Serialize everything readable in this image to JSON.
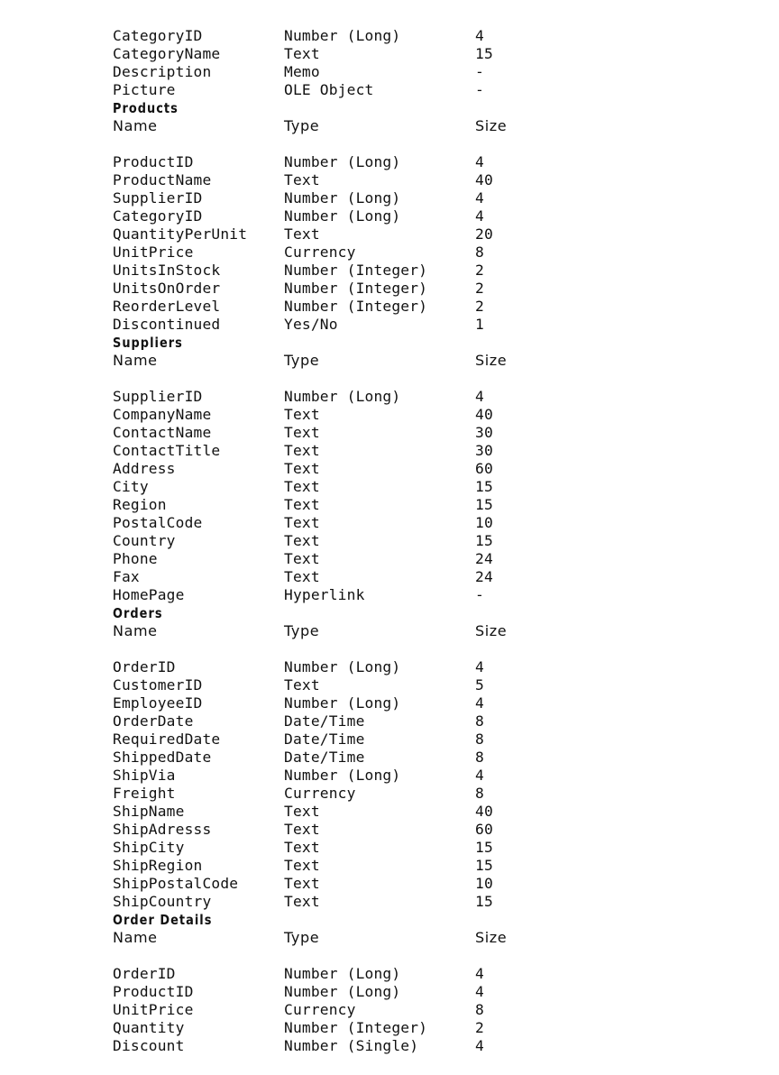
{
  "header_labels": {
    "name": "Name",
    "type": "Type",
    "size": "Size"
  },
  "tables": [
    {
      "title": "",
      "show_header": false,
      "fields": [
        [
          "CategoryID",
          "Number (Long)",
          "4"
        ],
        [
          "CategoryName",
          "Text",
          "15"
        ],
        [
          "Description",
          "Memo",
          "-"
        ],
        [
          "Picture",
          "OLE Object",
          "-"
        ]
      ]
    },
    {
      "title": "Products",
      "show_header": true,
      "fields": [
        [
          "ProductID",
          "Number (Long)",
          "4"
        ],
        [
          "ProductName",
          "Text",
          "40"
        ],
        [
          "SupplierID",
          "Number (Long)",
          "4"
        ],
        [
          "CategoryID",
          "Number (Long)",
          "4"
        ],
        [
          "QuantityPerUnit",
          "Text",
          "20"
        ],
        [
          "UnitPrice",
          "Currency",
          "8"
        ],
        [
          "UnitsInStock",
          "Number (Integer)",
          "2"
        ],
        [
          "UnitsOnOrder",
          "Number (Integer)",
          "2"
        ],
        [
          "ReorderLevel",
          "Number (Integer)",
          "2"
        ],
        [
          "Discontinued",
          "Yes/No",
          "1"
        ]
      ]
    },
    {
      "title": "Suppliers",
      "show_header": true,
      "fields": [
        [
          "SupplierID",
          "Number (Long)",
          "4"
        ],
        [
          "CompanyName",
          "Text",
          "40"
        ],
        [
          "ContactName",
          "Text",
          "30"
        ],
        [
          "ContactTitle",
          "Text",
          "30"
        ],
        [
          "Address",
          "Text",
          "60"
        ],
        [
          "City",
          "Text",
          "15"
        ],
        [
          "Region",
          "Text",
          "15"
        ],
        [
          "PostalCode",
          "Text",
          "10"
        ],
        [
          "Country",
          "Text",
          "15"
        ],
        [
          "Phone",
          "Text",
          "24"
        ],
        [
          "Fax",
          "Text",
          "24"
        ],
        [
          "HomePage",
          "Hyperlink",
          "-"
        ]
      ]
    },
    {
      "title": "Orders",
      "show_header": true,
      "fields": [
        [
          "OrderID",
          "Number (Long)",
          "4"
        ],
        [
          "CustomerID",
          "Text",
          "5"
        ],
        [
          "EmployeeID",
          "Number (Long)",
          "4"
        ],
        [
          "OrderDate",
          "Date/Time",
          "8"
        ],
        [
          "RequiredDate",
          "Date/Time",
          "8"
        ],
        [
          "ShippedDate",
          "Date/Time",
          "8"
        ],
        [
          "ShipVia",
          "Number (Long)",
          "4"
        ],
        [
          "Freight",
          "Currency",
          "8"
        ],
        [
          "ShipName",
          "Text",
          "40"
        ],
        [
          "ShipAdresss",
          "Text",
          "60"
        ],
        [
          "ShipCity",
          "Text",
          "15"
        ],
        [
          "ShipRegion",
          "Text",
          "15"
        ],
        [
          "ShipPostalCode",
          "Text",
          "10"
        ],
        [
          "ShipCountry",
          "Text",
          "15"
        ]
      ]
    },
    {
      "title": "Order Details",
      "show_header": true,
      "fields": [
        [
          "OrderID",
          "Number (Long)",
          "4"
        ],
        [
          "ProductID",
          "Number (Long)",
          "4"
        ],
        [
          "UnitPrice",
          "Currency",
          "8"
        ],
        [
          "Quantity",
          "Number (Integer)",
          "2"
        ],
        [
          "Discount",
          "Number (Single)",
          "4"
        ]
      ]
    }
  ]
}
